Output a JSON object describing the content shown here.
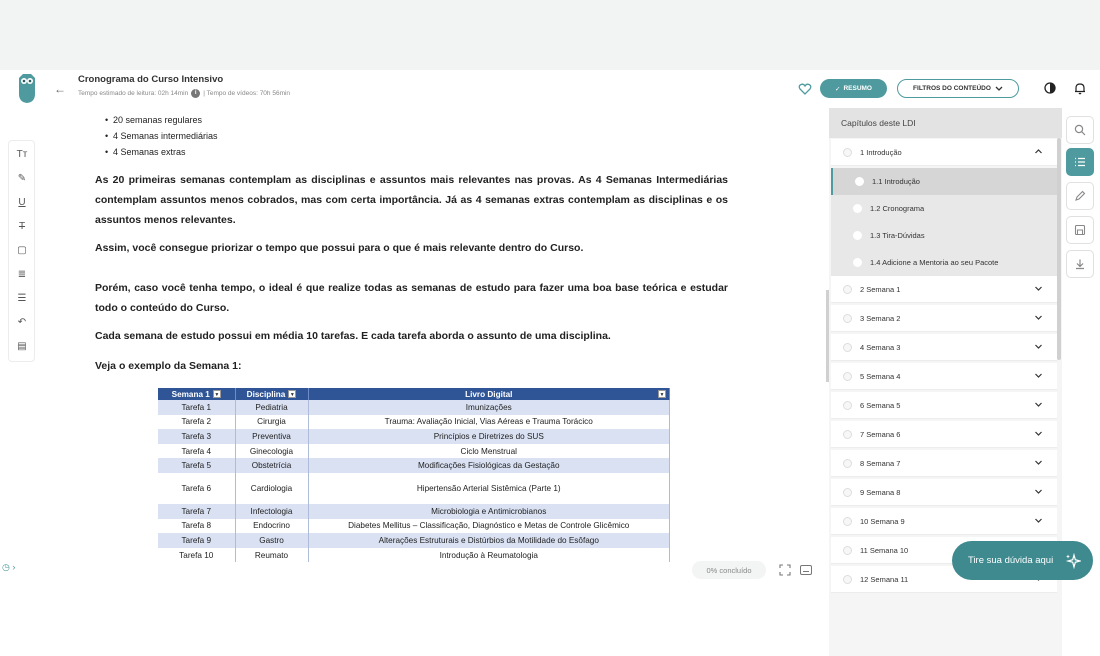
{
  "header": {
    "title": "Cronograma do Curso Intensivo",
    "reading_time": "Tempo estimado de leitura: 02h 14min",
    "info_icon": "i",
    "video_time": "| Tempo de vídeos: 70h 56min",
    "resumo_label": "RESUMO",
    "filtros_label": "FILTROS DO CONTEÚDO"
  },
  "content": {
    "bullets": [
      "20 semanas regulares",
      "4 Semanas intermediárias",
      "4 Semanas extras"
    ],
    "p1": "As 20 primeiras semanas contemplam as disciplinas e assuntos mais relevantes nas provas. As 4 Semanas Intermediárias contemplam assuntos menos cobrados, mas com certa importância. Já as 4 semanas extras contemplam as disciplinas e os assuntos menos relevantes.",
    "p2": "Assim, você consegue priorizar o tempo que possui para o que é mais relevante dentro do Curso.",
    "p3": "Porém, caso você tenha tempo, o ideal é que realize todas as semanas de estudo para fazer uma boa base teórica e estudar todo o conteúdo do Curso.",
    "p4": "Cada semana de estudo possui em média 10 tarefas. E cada tarefa aborda o assunto de uma disciplina.",
    "p5": "Veja o exemplo da Semana 1:"
  },
  "table": {
    "headers": [
      "Semana 1",
      "Disciplina",
      "Livro Digital"
    ],
    "rows": [
      [
        "Tarefa 1",
        "Pediatria",
        "Imunizações"
      ],
      [
        "Tarefa 2",
        "Cirurgia",
        "Trauma: Avaliação Inicial, Vias Aéreas e Trauma Torácico"
      ],
      [
        "Tarefa 3",
        "Preventiva",
        "Princípios e Diretrizes do SUS"
      ],
      [
        "Tarefa 4",
        "Ginecologia",
        "Ciclo Menstrual"
      ],
      [
        "Tarefa 5",
        "Obstetrícia",
        "Modificações Fisiológicas da Gestação"
      ],
      [
        "Tarefa 6",
        "Cardiologia",
        "Hipertensão Arterial Sistêmica (Parte 1)"
      ],
      [
        "Tarefa 7",
        "Infectologia",
        "Microbiologia e Antimicrobianos"
      ],
      [
        "Tarefa 8",
        "Endocrino",
        "Diabetes Mellitus – Classificação, Diagnóstico e Metas de Controle Glicêmico"
      ],
      [
        "Tarefa 9",
        "Gastro",
        "Alterações Estruturais e Distúrbios da Motilidade do Esôfago"
      ],
      [
        "Tarefa 10",
        "Reumato",
        "Introdução à Reumatologia"
      ]
    ]
  },
  "progress": "0% concluído",
  "sidebar": {
    "title": "Capítulos deste LDI",
    "chapter1": "1 Introdução",
    "subs": [
      "1.1 Introdução",
      "1.2 Cronograma",
      "1.3 Tira-Dúvidas",
      "1.4 Adicione a Mentoria ao seu Pacote"
    ],
    "weeks": [
      "2 Semana 1",
      "3 Semana 2",
      "4 Semana 3",
      "5 Semana 4",
      "6 Semana 5",
      "7 Semana 6",
      "8 Semana 7",
      "9 Semana 8",
      "10 Semana 9",
      "11 Semana 10",
      "12 Semana 11"
    ]
  },
  "help_label": "Tire sua dúvida aqui",
  "colors": {
    "accent": "#4e9a9e",
    "table_header": "#2f5597",
    "table_alt": "#d9e1f2"
  }
}
